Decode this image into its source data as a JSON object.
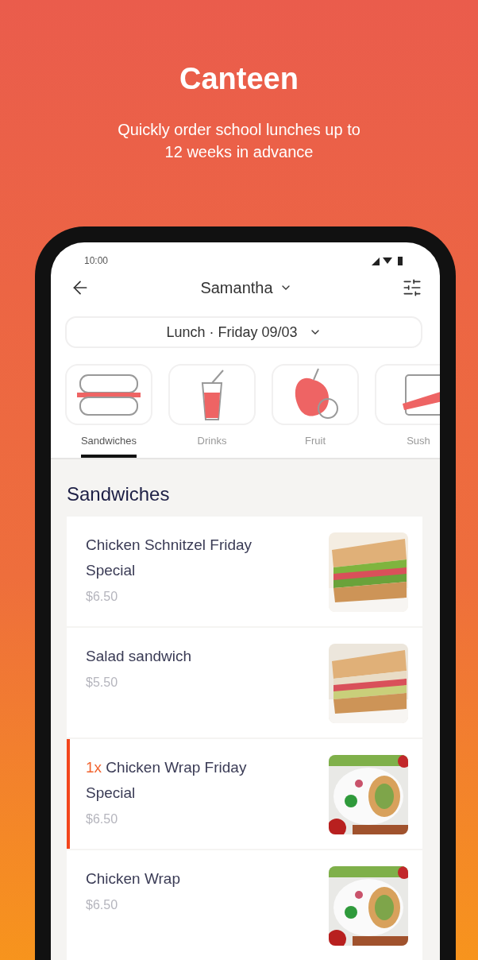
{
  "header": {
    "title": "Canteen",
    "subtitle": "Quickly order school lunches up to 12 weeks in advance"
  },
  "status_bar": {
    "time": "10:00"
  },
  "app_bar": {
    "child": "Samantha"
  },
  "date_selector": {
    "label": "Lunch · Friday 09/03"
  },
  "categories": [
    {
      "label": "Sandwiches",
      "selected": true
    },
    {
      "label": "Drinks",
      "selected": false
    },
    {
      "label": "Fruit",
      "selected": false
    },
    {
      "label": "Sush",
      "selected": false
    }
  ],
  "section_title": "Sandwiches",
  "items": [
    {
      "name": "Chicken Schnitzel Friday Special",
      "price": "$6.50",
      "in_cart": false
    },
    {
      "name": "Salad sandwich",
      "price": "$5.50",
      "in_cart": false
    },
    {
      "quantity": "1x",
      "name": "Chicken Wrap Friday Special",
      "price": "$6.50",
      "in_cart": true
    },
    {
      "name": "Chicken Wrap",
      "price": "$6.50",
      "in_cart": false
    }
  ]
}
